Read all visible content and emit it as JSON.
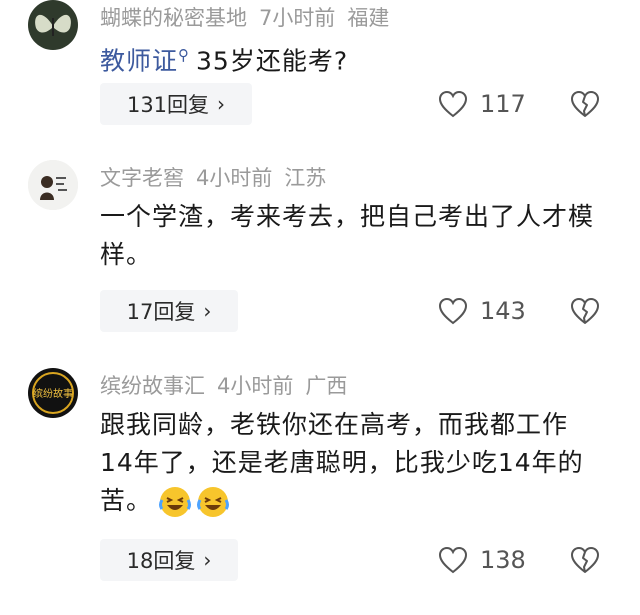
{
  "comments": [
    {
      "username": "蝴蝶的秘密基地",
      "time": "7小时前",
      "location": "福建",
      "link_text": "教师证",
      "search_icon": "search-icon",
      "text": "35岁还能考?",
      "reply_label": "131回复",
      "likes": "117"
    },
    {
      "username": "文字老窖",
      "time": "4小时前",
      "location": "江苏",
      "text": "一个学渣，考来考去，把自己考出了人才模样。",
      "reply_label": "17回复",
      "likes": "143"
    },
    {
      "username": "缤纷故事汇",
      "time": "4小时前",
      "location": "广西",
      "text": "跟我同龄，老铁你还在高考，而我都工作14年了，还是老唐聪明，比我少吃14年的苦。",
      "emojis": [
        "laughing-crying-emoji",
        "laughing-crying-emoji"
      ],
      "reply_label": "18回复",
      "likes": "138",
      "avatar_text": "缤纷故事"
    }
  ],
  "colors": {
    "link": "#3d5a9e",
    "meta": "#9a9a9a",
    "button_bg": "#f4f5f7"
  }
}
